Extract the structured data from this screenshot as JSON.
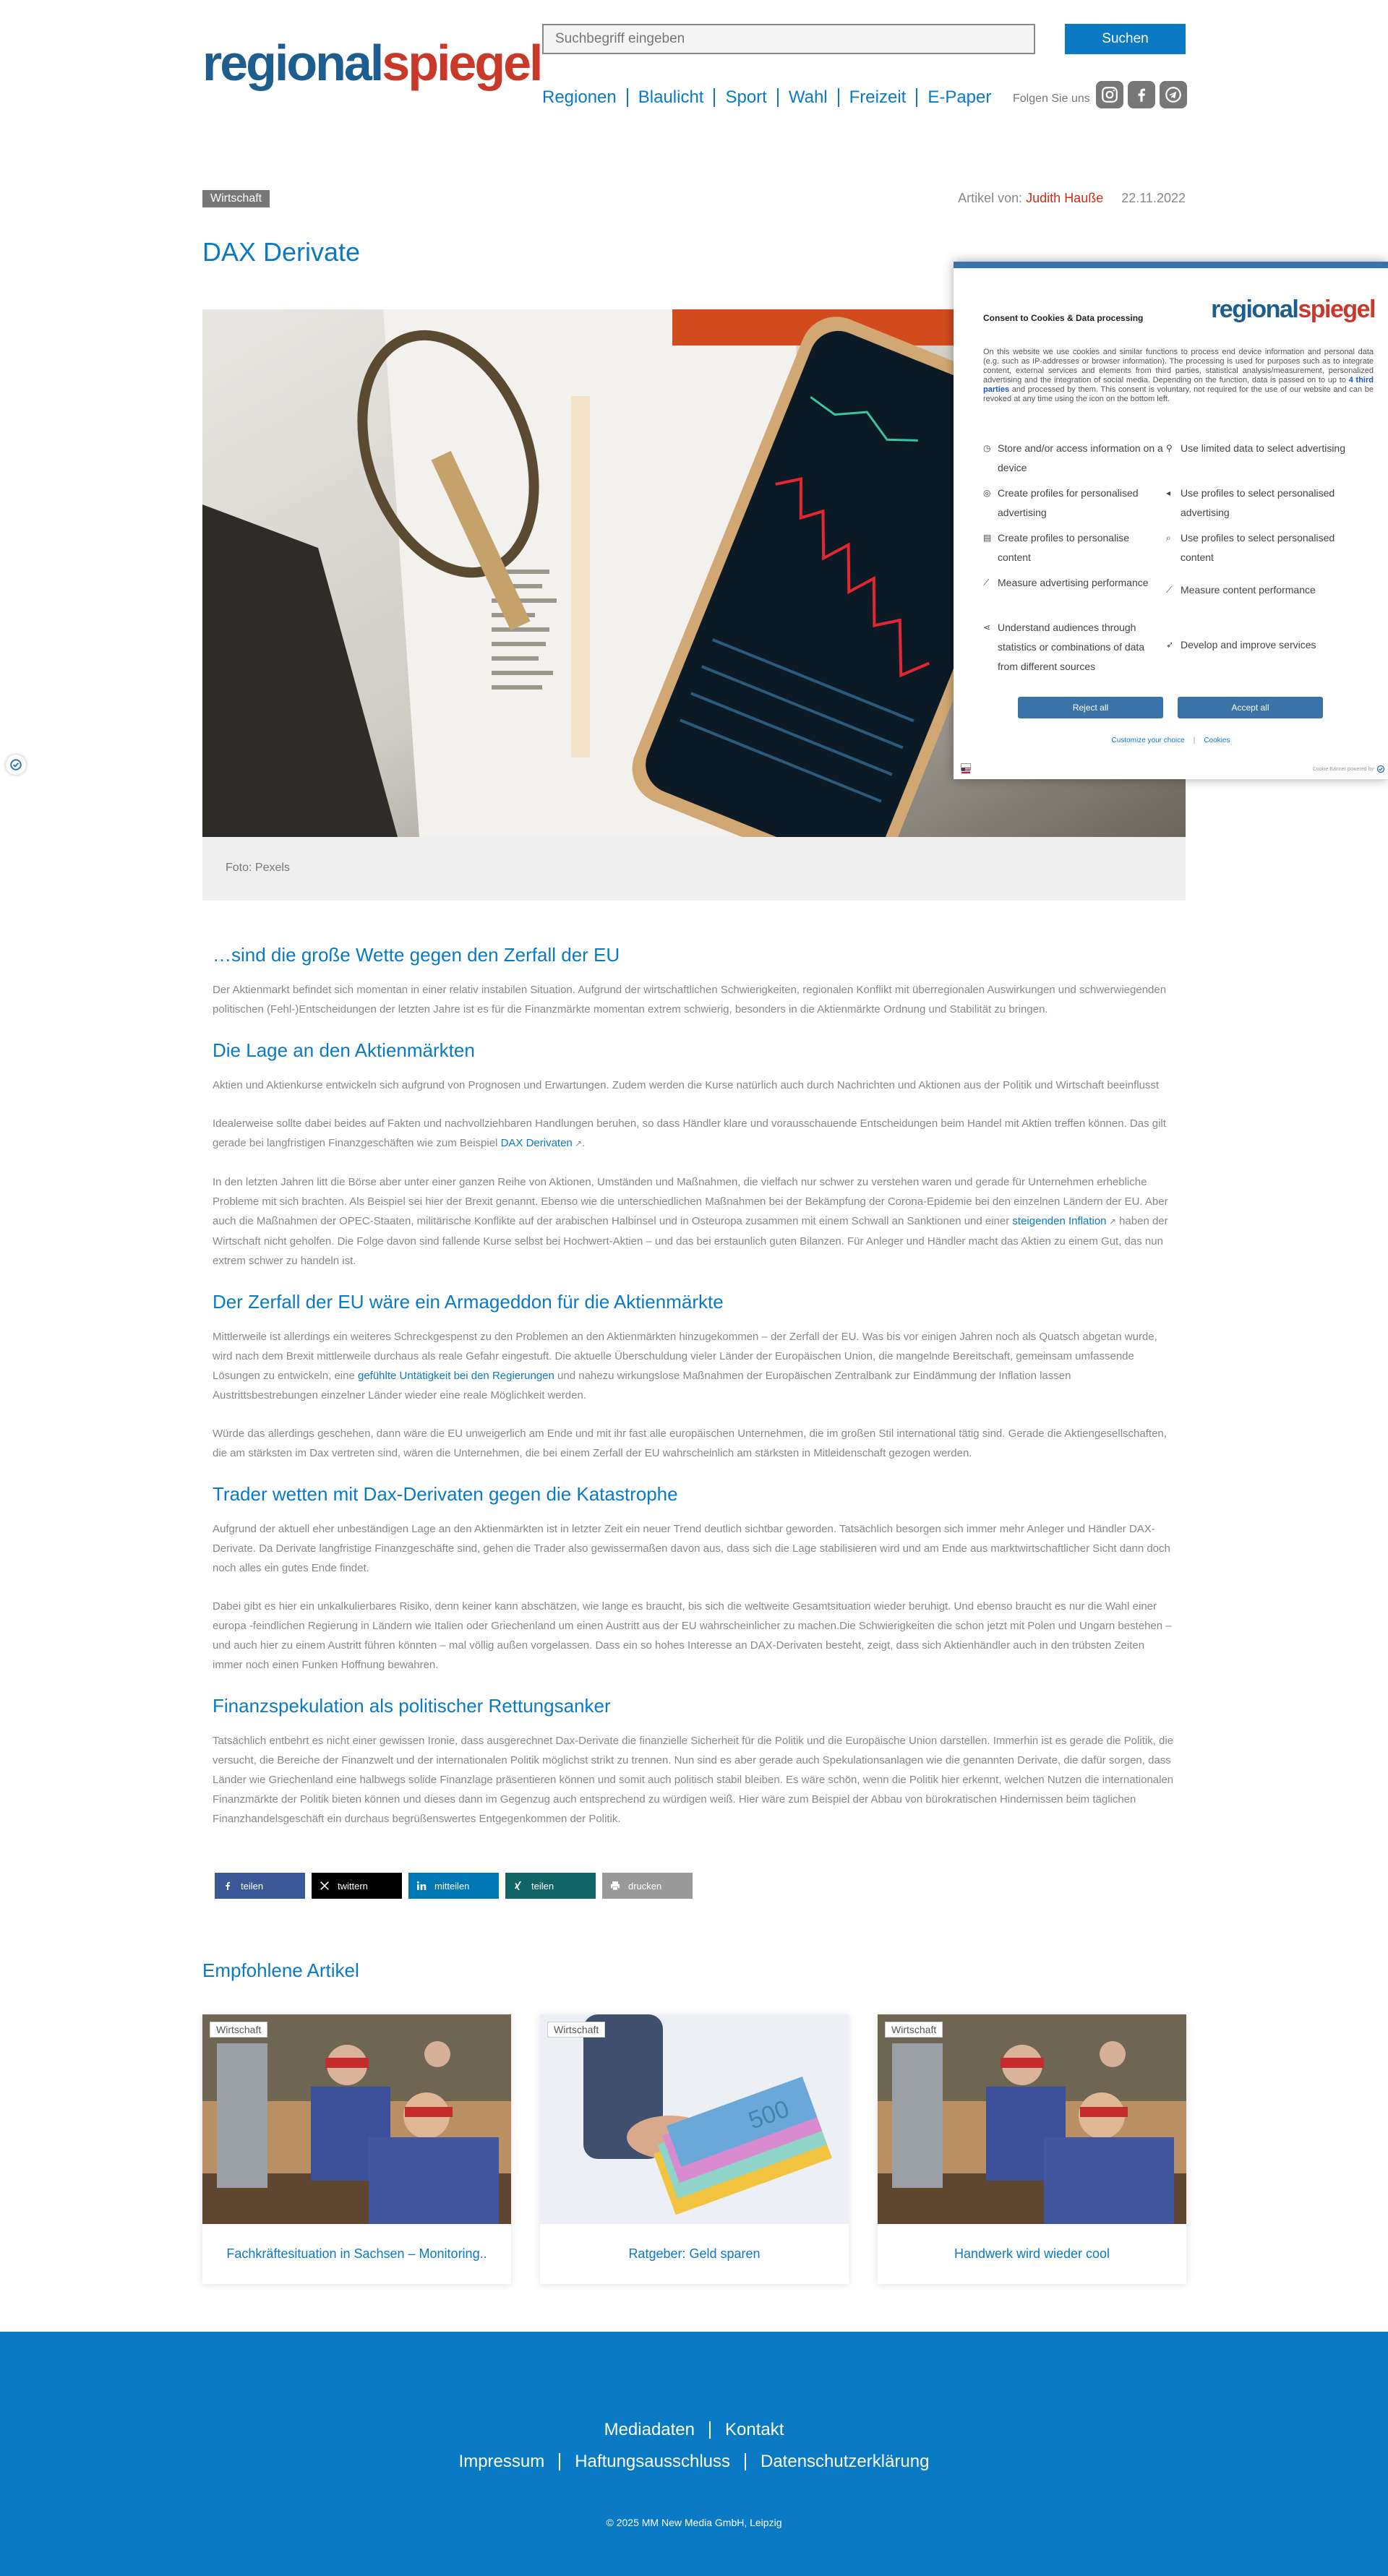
{
  "header": {
    "logo_part1": "regional",
    "logo_part2": "spiegel",
    "search_placeholder": "Suchbegriff eingeben",
    "search_button": "Suchen",
    "nav": [
      "Regionen",
      "Blaulicht",
      "Sport",
      "Wahl",
      "Freizeit",
      "E-Paper"
    ],
    "follow_label": "Folgen Sie uns",
    "social": [
      "instagram-icon",
      "facebook-icon",
      "telegram-icon"
    ]
  },
  "article": {
    "category": "Wirtschaft",
    "author_label": "Artikel von:",
    "author": "Judith Hauße",
    "date": "22.11.2022",
    "title": "DAX Derivate",
    "image_caption": "Foto: Pexels",
    "h_intro": "…sind die große Wette gegen den Zerfall der EU",
    "p_intro": "Der Aktienmarkt befindet sich momentan in einer relativ instabilen Situation. Aufgrund der wirtschaftlichen Schwierigkeiten, regionalen Konflikt mit überregionalen Auswirkungen und schwerwiegenden politischen (Fehl-)Entscheidungen der letzten Jahre ist es für die Finanzmärkte momentan extrem schwierig, besonders in die Aktienmärkte Ordnung und Stabilität zu bringen.",
    "h1": "Die Lage an den Aktienmärkten",
    "p1": "Aktien und Aktienkurse entwickeln sich aufgrund von Prognosen und Erwartungen. Zudem werden die Kurse natürlich auch durch Nachrichten und Aktionen aus der Politik und Wirtschaft beeinflusst",
    "p2_a": "Idealerweise sollte dabei beides auf Fakten und nachvollziehbaren Handlungen beruhen, so dass Händler klare und vorausschauende Entscheidungen beim Handel mit Aktien treffen können. Das gilt gerade bei langfristigen Finanzgeschäften wie zum Beispiel ",
    "p2_link": "DAX Derivaten",
    "p2_b": ".",
    "p3_a": "In den letzten Jahren litt die Börse aber unter einer ganzen Reihe von Aktionen, Umständen und Maßnahmen, die vielfach nur schwer zu verstehen waren und gerade für Unternehmen erhebliche Probleme mit sich brachten. Als Beispiel sei hier der Brexit genannt. Ebenso wie die unterschiedlichen Maßnahmen bei der Bekämpfung der Corona-Epidemie bei den einzelnen Ländern der EU. Aber auch die Maßnahmen der OPEC-Staaten, militärische Konflikte auf der arabischen Halbinsel und in Osteuropa zusammen mit einem Schwall an Sanktionen und einer ",
    "p3_link": "steigenden Inflation",
    "p3_b": " haben der Wirtschaft nicht geholfen. Die Folge davon sind fallende Kurse selbst bei Hochwert-Aktien – und das bei erstaunlich guten Bilanzen. Für Anleger und Händler macht das Aktien zu einem Gut, das nun extrem schwer zu handeln ist.",
    "h2": "Der Zerfall der EU wäre ein Armageddon für die Aktienmärkte",
    "p4_a": "Mittlerweile ist allerdings ein weiteres Schreckgespenst zu den Problemen an den Aktienmärkten hinzugekommen – der Zerfall der EU. Was bis vor einigen Jahren noch als Quatsch abgetan wurde, wird nach dem Brexit mittlerweile durchaus als reale Gefahr eingestuft. Die aktuelle Überschuldung vieler Länder der Europäischen Union, die mangelnde Bereitschaft, gemeinsam umfassende Lösungen zu entwickeln, eine ",
    "p4_link": "gefühlte Untätigkeit bei den Regierungen",
    "p4_b": " und nahezu wirkungslose Maßnahmen der Europäischen Zentralbank zur Eindämmung der Inflation lassen Austrittsbestrebungen einzelner Länder wieder eine reale Möglichkeit werden.",
    "p5": "Würde das allerdings geschehen, dann wäre die EU unweigerlich am Ende und mit ihr fast alle europäischen Unternehmen, die im großen Stil international tätig sind. Gerade die Aktiengesellschaften, die am stärksten im Dax vertreten sind, wären die Unternehmen, die bei einem Zerfall der EU wahrscheinlich am stärksten in Mitleidenschaft gezogen werden.",
    "h3": "Trader wetten mit Dax-Derivaten gegen die Katastrophe",
    "p6": "Aufgrund der aktuell eher unbeständigen Lage an den Aktienmärkten ist in letzter Zeit ein neuer Trend deutlich sichtbar geworden. Tatsächlich besorgen sich immer mehr Anleger und Händler DAX-Derivate. Da Derivate langfristige Finanzgeschäfte sind, gehen die Trader also gewissermaßen davon aus, dass sich die Lage stabilisieren wird und am Ende aus marktwirtschaftlicher Sicht dann doch noch alles ein gutes Ende findet.",
    "p7": "Dabei gibt es hier ein unkalkulierbares Risiko, denn keiner kann abschätzen, wie lange es braucht, bis sich die weltweite Gesamtsituation wieder beruhigt. Und ebenso braucht es nur die Wahl einer europa -feindlichen Regierung in Ländern wie Italien oder Griechenland um einen Austritt aus der EU wahrscheinlicher zu machen.Die Schwierigkeiten die schon jetzt mit Polen und Ungarn bestehen – und auch hier zu einem Austritt führen könnten – mal völlig außen vorgelassen. Dass ein so hohes Interesse an DAX-Derivaten besteht, zeigt, dass sich Aktienhändler auch in den trübsten Zeiten immer noch einen Funken Hoffnung bewahren.",
    "h4": "Finanzspekulation als politischer Rettungsanker",
    "p8": " Tatsächlich entbehrt es nicht einer gewissen Ironie, dass ausgerechnet Dax-Derivate die finanzielle Sicherheit für die Politik und die Europäische Union darstellen. Immerhin ist es gerade die Politik, die versucht, die Bereiche der Finanzwelt und der internationalen Politik möglichst strikt zu trennen. Nun sind es aber gerade auch Spekulationsanlagen wie die genannten Derivate, die dafür sorgen, dass Länder wie Griechenland eine halbwegs solide Finanzlage präsentieren können und somit auch politisch stabil bleiben. Es wäre schön, wenn die Politik hier erkennt, welchen Nutzen die internationalen Finanzmärkte der Politik bieten können und dieses dann im Gegenzug auch entsprechend zu würdigen weiß. Hier wäre zum Beispiel der Abbau von bürokratischen Hindernissen beim täglichen Finanzhandelsgeschäft ein durchaus begrüßenswertes Entgegenkommen der Politik."
  },
  "share": [
    {
      "label": "teilen",
      "icon": "facebook-icon",
      "color": "#3b5998"
    },
    {
      "label": "twittern",
      "icon": "x-icon",
      "color": "#000000"
    },
    {
      "label": "mitteilen",
      "icon": "linkedin-icon",
      "color": "#0077b5"
    },
    {
      "label": "teilen",
      "icon": "xing-icon",
      "color": "#126567"
    },
    {
      "label": "drucken",
      "icon": "print-icon",
      "color": "#999999"
    }
  ],
  "recommended": {
    "title": "Empfohlene Artikel",
    "items": [
      {
        "tag": "Wirtschaft",
        "caption": "Fachkräftesituation in Sachsen – Monitoring.."
      },
      {
        "tag": "Wirtschaft",
        "caption": "Ratgeber: Geld sparen"
      },
      {
        "tag": "Wirtschaft",
        "caption": "Handwerk wird wieder cool"
      }
    ]
  },
  "footer": {
    "row1": [
      "Mediadaten",
      "Kontakt"
    ],
    "row2": [
      "Impressum",
      "Haftungsausschluss",
      "Datenschutzerklärung"
    ],
    "copyright": "© 2025 MM New Media GmbH, Leipzig"
  },
  "cookie": {
    "title": "Consent to Cookies & Data processing",
    "logo_part1": "regional",
    "logo_part2": "spiegel",
    "text_a": "On this website we use cookies and similar functions to process end device information and personal data (e.g. such as IP-addresses or browser information). The processing is used for purposes such as to integrate content, external services and elements from third parties, statistical analysis/measurement, personalized advertising and the integration of social media. Depending on the function, data is passed on to up to ",
    "text_bold": "4 third parties",
    "text_b": " and processed by them. This consent is voluntary, not required for the use of our website and can be revoked at any time using the icon on the bottom left.",
    "purposes_left": [
      "Store and/or access information on a device",
      "Create profiles for personalised advertising",
      "Create profiles to personalise content",
      "Measure advertising performance",
      "Understand audiences through statistics or combinations of data from different sources"
    ],
    "purposes_right": [
      "Use limited data to select advertising",
      "Use profiles to select personalised advertising",
      "Use profiles to select personalised content",
      "Measure content performance",
      "Develop and improve services"
    ],
    "reject": "Reject all",
    "accept": "Accept all",
    "customize": "Customize your choice",
    "cookies_link": "Cookies",
    "powered": "Cookie Banner powered by"
  }
}
